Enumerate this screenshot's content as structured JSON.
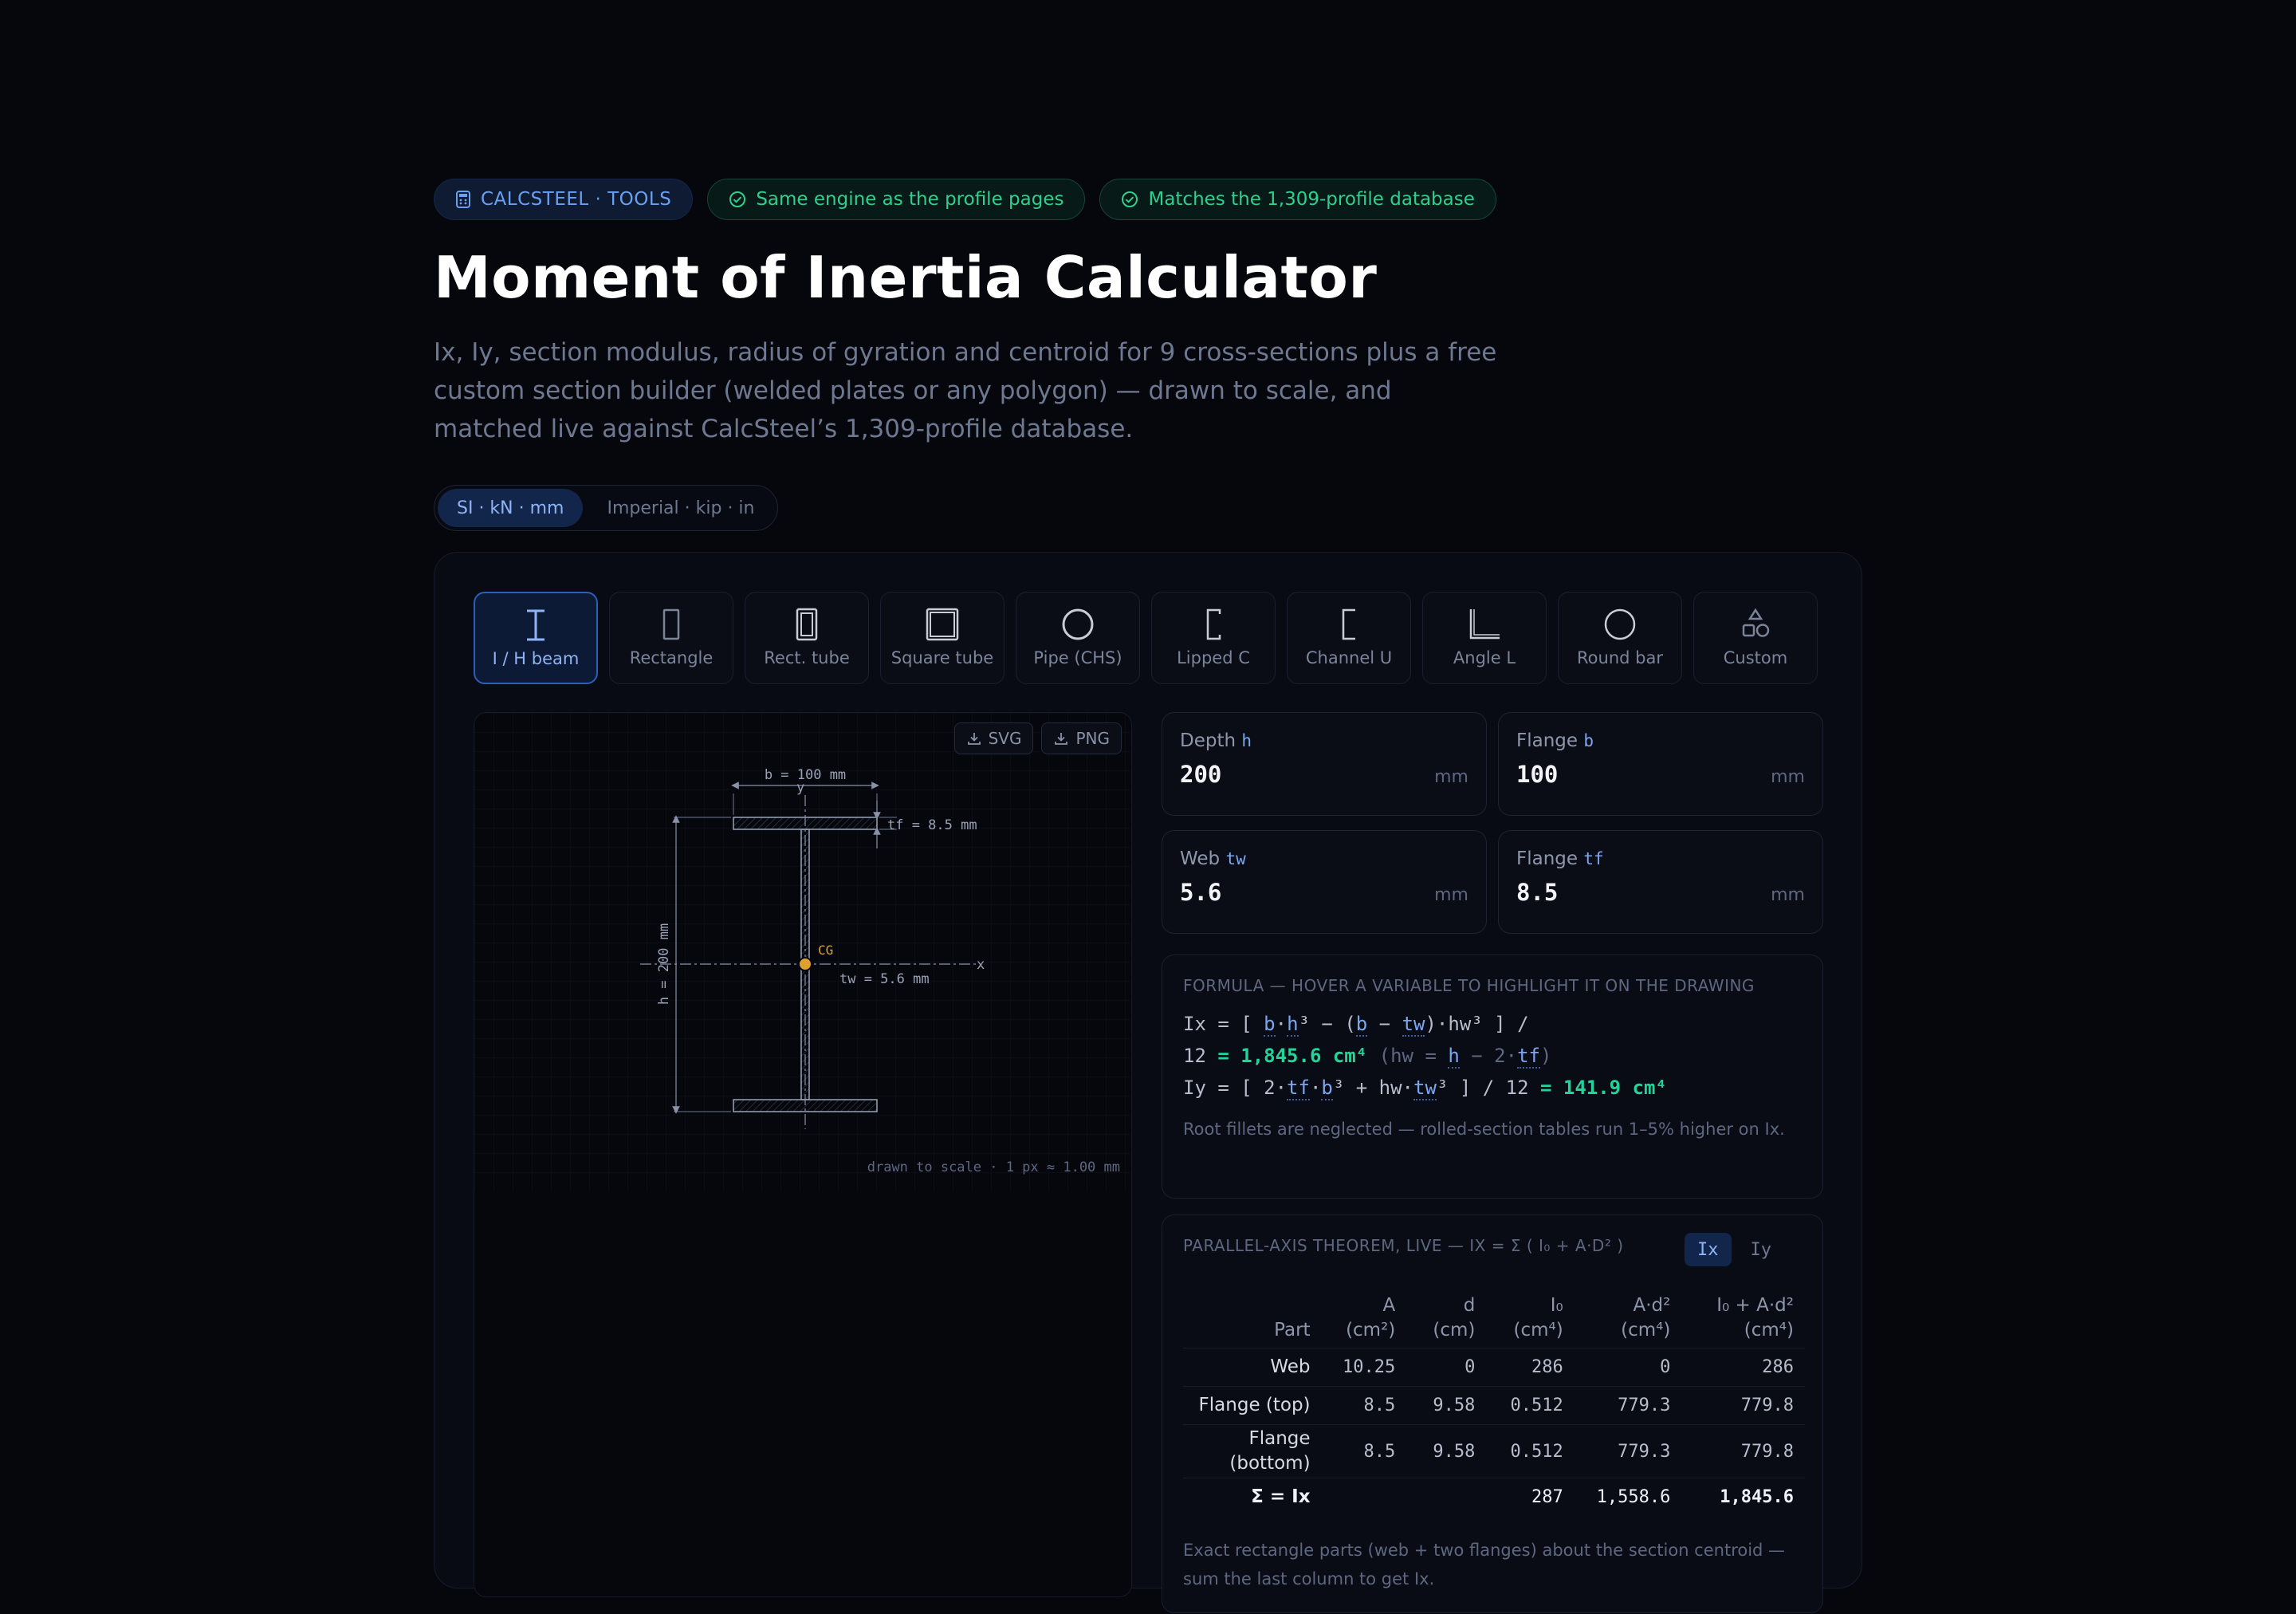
{
  "badges": {
    "tools": "CALCSTEEL · TOOLS",
    "engine": "Same engine as the profile pages",
    "database": "Matches the 1,309-profile database"
  },
  "title": "Moment of Inertia Calculator",
  "lede": "Ix, Iy, section modulus, radius of gyration and centroid for 9 cross-sections plus a free custom section builder (welded plates or any polygon) — drawn to scale, and matched live against CalcSteel’s 1,309-profile database.",
  "units": {
    "si": "SI · kN · mm",
    "imperial": "Imperial · kip · in",
    "selected": "si"
  },
  "sections": [
    {
      "label": "I / H beam",
      "icon": "i-beam-icon",
      "active": true
    },
    {
      "label": "Rectangle",
      "icon": "rectangle-icon"
    },
    {
      "label": "Rect. tube",
      "icon": "rect-tube-icon"
    },
    {
      "label": "Square tube",
      "icon": "square-tube-icon"
    },
    {
      "label": "Pipe (CHS)",
      "icon": "pipe-icon"
    },
    {
      "label": "Lipped C",
      "icon": "lipped-c-icon"
    },
    {
      "label": "Channel U",
      "icon": "channel-icon"
    },
    {
      "label": "Angle L",
      "icon": "angle-icon"
    },
    {
      "label": "Round bar",
      "icon": "round-bar-icon"
    },
    {
      "label": "Custom",
      "icon": "shapes-icon"
    }
  ],
  "drawing": {
    "svg_label": "SVG",
    "png_label": "PNG",
    "dim_b": "b = 100 mm",
    "dim_tf": "tf = 8.5 mm",
    "dim_h": "h = 200 mm",
    "dim_tw": "tw = 5.6 mm",
    "cg": "CG",
    "axis_x": "x",
    "axis_y": "y",
    "scale_note": "drawn to scale · 1 px ≈ 1.00 mm"
  },
  "inputs": [
    {
      "label": "Depth",
      "sym": "h",
      "value": "200",
      "unit": "mm"
    },
    {
      "label": "Flange",
      "sym": "b",
      "value": "100",
      "unit": "mm"
    },
    {
      "label": "Web",
      "sym": "tw",
      "value": "5.6",
      "unit": "mm"
    },
    {
      "label": "Flange",
      "sym": "tf",
      "value": "8.5",
      "unit": "mm"
    }
  ],
  "formula": {
    "heading": "FORMULA — HOVER A VARIABLE TO HIGHLIGHT IT ON THE DRAWING",
    "ix_result": "= 1,845.6 cm⁴",
    "iy_result": "= 141.9 cm⁴",
    "note": "Root fillets are neglected — rolled-section tables run 1–5% higher on Ix."
  },
  "parallel_axis": {
    "heading": "PARALLEL-AXIS THEOREM, LIVE — IX = Σ ( I₀ + A·D² )",
    "toggle": [
      "Ix",
      "Iy"
    ],
    "columns": [
      {
        "name": "Part",
        "unit": ""
      },
      {
        "name": "A",
        "unit": "(cm²)"
      },
      {
        "name": "d",
        "unit": "(cm)"
      },
      {
        "name": "I₀",
        "unit": "(cm⁴)"
      },
      {
        "name": "A·d²",
        "unit": "(cm⁴)"
      },
      {
        "name": "I₀ + A·d²",
        "unit": "(cm⁴)"
      }
    ],
    "rows": [
      {
        "part": "Web",
        "A": "10.25",
        "d": "0",
        "I0": "286",
        "Ad2": "0",
        "sum": "286"
      },
      {
        "part": "Flange (top)",
        "A": "8.5",
        "d": "9.58",
        "I0": "0.512",
        "Ad2": "779.3",
        "sum": "779.8"
      },
      {
        "part": "Flange (bottom)",
        "A": "8.5",
        "d": "9.58",
        "I0": "0.512",
        "Ad2": "779.3",
        "sum": "779.8"
      }
    ],
    "total": {
      "part": "Σ = Ix",
      "A": "",
      "d": "",
      "I0": "287",
      "Ad2": "1,558.6",
      "sum": "1,845.6"
    },
    "note": "Exact rectangle parts (web + two flanges) about the section centroid — sum the last column to get Ix."
  }
}
